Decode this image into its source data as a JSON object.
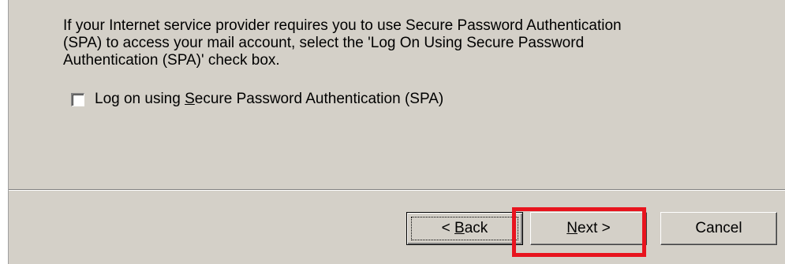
{
  "dialog": {
    "info_text": "If your Internet service provider requires you to use Secure Password Authentication\n(SPA) to access your mail account, select the 'Log On Using Secure Password\nAuthentication (SPA)' check box.",
    "checkbox": {
      "label_pre": "Log on using ",
      "label_accel": "S",
      "label_post": "ecure Password Authentication (SPA)",
      "checked": false
    }
  },
  "footer": {
    "back": {
      "pre": "< ",
      "accel": "B",
      "post": "ack"
    },
    "next": {
      "accel": "N",
      "post": "ext >"
    },
    "cancel": "Cancel"
  },
  "highlight": {
    "color": "#e8141e",
    "target": "next-button"
  },
  "colors": {
    "face": "#d4d0c8"
  }
}
